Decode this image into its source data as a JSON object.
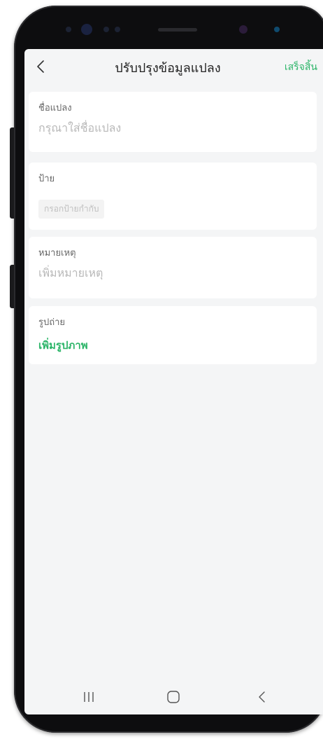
{
  "header": {
    "title": "ปรับปรุงข้อมูลแปลง",
    "done_label": "เสร็จสิ้น"
  },
  "form": {
    "plot_name": {
      "label": "ชื่อแปลง",
      "placeholder": "กรุณาใส่ชื่อแปลง",
      "value": ""
    },
    "tag": {
      "label": "ป้าย",
      "chip": "กรอกป้ายกำกับ"
    },
    "note": {
      "label": "หมายเหตุ",
      "placeholder": "เพิ่มหมายเหตุ",
      "value": ""
    },
    "photo": {
      "label": "รูปถ่าย",
      "add_label": "เพิ่มรูปภาพ"
    }
  },
  "icons": {
    "back": "chevron-left-icon",
    "recents": "recents-icon",
    "home": "home-icon",
    "nav_back": "nav-back-icon"
  },
  "colors": {
    "accent": "#2db569",
    "background": "#f4f5f6",
    "card": "#ffffff"
  }
}
